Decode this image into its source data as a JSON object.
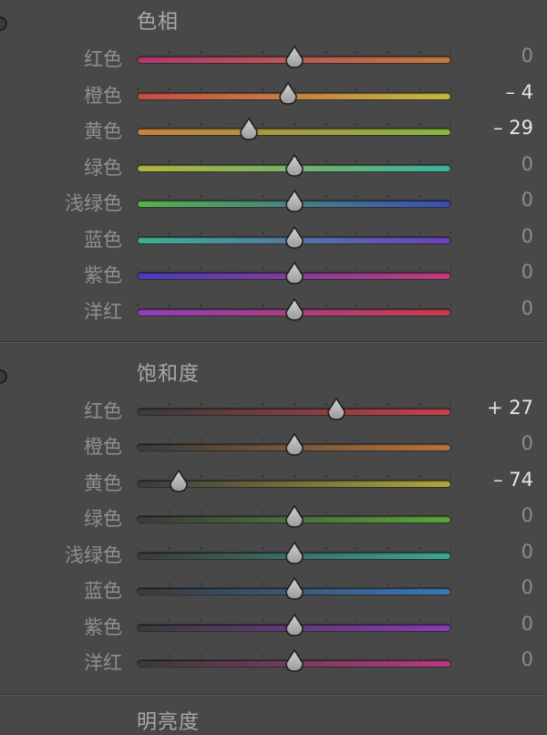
{
  "sections": [
    {
      "id": "hue",
      "title": "色相",
      "rows": [
        {
          "label": "红色",
          "value": "0",
          "amount": 0,
          "left": "#b3356f",
          "right": "#c47a3c"
        },
        {
          "label": "橙色",
          "value": "– 4",
          "amount": -4,
          "left": "#c94b46",
          "right": "#c2bb3e"
        },
        {
          "label": "黄色",
          "value": "– 29",
          "amount": -29,
          "left": "#c9813b",
          "right": "#86b840"
        },
        {
          "label": "绿色",
          "value": "0",
          "amount": 0,
          "left": "#b2b33a",
          "right": "#3ab39e"
        },
        {
          "label": "浅绿色",
          "value": "0",
          "amount": 0,
          "left": "#56b34a",
          "right": "#3a4db8"
        },
        {
          "label": "蓝色",
          "value": "0",
          "amount": 0,
          "left": "#3cb08f",
          "right": "#6a3fbb"
        },
        {
          "label": "紫色",
          "value": "0",
          "amount": 0,
          "left": "#4a3cbb",
          "right": "#c03c7a"
        },
        {
          "label": "洋红",
          "value": "0",
          "amount": 0,
          "left": "#8e3fbb",
          "right": "#c83c48"
        }
      ]
    },
    {
      "id": "saturation",
      "title": "饱和度",
      "rows": [
        {
          "label": "红色",
          "value": "+ 27",
          "amount": 27,
          "left": "#3a3a3a",
          "right": "#c8404a"
        },
        {
          "label": "橙色",
          "value": "0",
          "amount": 0,
          "left": "#3a3a3a",
          "right": "#b8743a"
        },
        {
          "label": "黄色",
          "value": "– 74",
          "amount": -74,
          "left": "#3a3a3a",
          "right": "#b0a83a"
        },
        {
          "label": "绿色",
          "value": "0",
          "amount": 0,
          "left": "#3a3a3a",
          "right": "#5aa63a"
        },
        {
          "label": "浅绿色",
          "value": "0",
          "amount": 0,
          "left": "#3a3a3a",
          "right": "#3aa894"
        },
        {
          "label": "蓝色",
          "value": "0",
          "amount": 0,
          "left": "#3a3a3a",
          "right": "#3a78b8"
        },
        {
          "label": "紫色",
          "value": "0",
          "amount": 0,
          "left": "#3a3a3a",
          "right": "#8a3ab8"
        },
        {
          "label": "洋红",
          "value": "0",
          "amount": 0,
          "left": "#3a3a3a",
          "right": "#b83a82"
        }
      ]
    },
    {
      "id": "luminance",
      "title": "明亮度",
      "rows": []
    }
  ]
}
